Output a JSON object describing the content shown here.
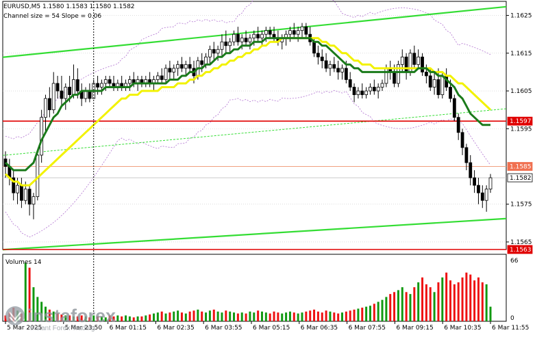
{
  "header": {
    "symbol_line": "EURUSD,M5  1.1580 1.1583 1.1580 1.1582",
    "indicator_line": "Channel size = 54 Slope = 0.06"
  },
  "colors": {
    "background": "#ffffff",
    "grid": "#c8c8c8",
    "candle": "#000000",
    "ma_fast": "#1a7a1a",
    "ma_slow": "#f2f200",
    "channel": "#33dd33",
    "level_line": "#e00000",
    "level_thin": "#f0a080",
    "envelope": "#b070d0",
    "vol_up": "#119911",
    "vol_down": "#ee1111"
  },
  "chart_data": {
    "type": "candlestick",
    "symbol": "EURUSD",
    "timeframe": "M5",
    "ohlc": [
      [
        1.1587,
        1.1589,
        1.1582,
        1.1585
      ],
      [
        1.1585,
        1.1587,
        1.158,
        1.1582
      ],
      [
        1.1582,
        1.1584,
        1.1576,
        1.1578
      ],
      [
        1.1578,
        1.1582,
        1.1575,
        1.158
      ],
      [
        1.158,
        1.1582,
        1.1574,
        1.1576
      ],
      [
        1.1576,
        1.1581,
        1.1575,
        1.1579
      ],
      [
        1.1579,
        1.158,
        1.1572,
        1.1575
      ],
      [
        1.1575,
        1.1578,
        1.1571,
        1.1577
      ],
      [
        1.1577,
        1.1589,
        1.1576,
        1.1588
      ],
      [
        1.1588,
        1.16,
        1.1586,
        1.1598
      ],
      [
        1.1598,
        1.1604,
        1.1594,
        1.1603
      ],
      [
        1.1603,
        1.1606,
        1.1598,
        1.16
      ],
      [
        1.16,
        1.161,
        1.1599,
        1.1607
      ],
      [
        1.1607,
        1.1609,
        1.1603,
        1.1605
      ],
      [
        1.1605,
        1.1609,
        1.1601,
        1.1603
      ],
      [
        1.1603,
        1.1607,
        1.16,
        1.1606
      ],
      [
        1.1606,
        1.1609,
        1.1602,
        1.1604
      ],
      [
        1.1604,
        1.1612,
        1.1603,
        1.1608
      ],
      [
        1.1608,
        1.1611,
        1.1603,
        1.1605
      ],
      [
        1.1605,
        1.1607,
        1.1601,
        1.1603
      ],
      [
        1.1603,
        1.1606,
        1.1602,
        1.1605
      ],
      [
        1.1605,
        1.1607,
        1.1602,
        1.1603
      ],
      [
        1.1603,
        1.1608,
        1.1603,
        1.1607
      ],
      [
        1.1607,
        1.1609,
        1.1604,
        1.1606
      ],
      [
        1.1606,
        1.1608,
        1.1604,
        1.1607
      ],
      [
        1.1607,
        1.1609,
        1.1605,
        1.1608
      ],
      [
        1.1608,
        1.1609,
        1.1606,
        1.1607
      ],
      [
        1.1607,
        1.1609,
        1.1605,
        1.1606
      ],
      [
        1.1606,
        1.1608,
        1.1605,
        1.1607
      ],
      [
        1.1607,
        1.1609,
        1.1605,
        1.1606
      ],
      [
        1.1606,
        1.1608,
        1.1605,
        1.1607
      ],
      [
        1.1607,
        1.1609,
        1.1605,
        1.1608
      ],
      [
        1.1608,
        1.161,
        1.1606,
        1.1607
      ],
      [
        1.1607,
        1.1609,
        1.1605,
        1.1608
      ],
      [
        1.1608,
        1.1609,
        1.1606,
        1.1607
      ],
      [
        1.1607,
        1.1609,
        1.1606,
        1.1608
      ],
      [
        1.1608,
        1.161,
        1.1606,
        1.1607
      ],
      [
        1.1607,
        1.1609,
        1.1605,
        1.1608
      ],
      [
        1.1608,
        1.161,
        1.1607,
        1.1609
      ],
      [
        1.1609,
        1.1611,
        1.1607,
        1.1608
      ],
      [
        1.1608,
        1.1612,
        1.1607,
        1.1611
      ],
      [
        1.1611,
        1.1613,
        1.1608,
        1.161
      ],
      [
        1.161,
        1.1612,
        1.1608,
        1.1611
      ],
      [
        1.1611,
        1.1613,
        1.1609,
        1.1612
      ],
      [
        1.1612,
        1.1614,
        1.161,
        1.1611
      ],
      [
        1.1611,
        1.1613,
        1.1609,
        1.1612
      ],
      [
        1.1612,
        1.1614,
        1.161,
        1.1611
      ],
      [
        1.1611,
        1.1613,
        1.1607,
        1.1609
      ],
      [
        1.1609,
        1.1614,
        1.1608,
        1.1613
      ],
      [
        1.1613,
        1.1615,
        1.161,
        1.1612
      ],
      [
        1.1612,
        1.1615,
        1.1611,
        1.1614
      ],
      [
        1.1614,
        1.1617,
        1.1612,
        1.1616
      ],
      [
        1.1616,
        1.1618,
        1.1613,
        1.1615
      ],
      [
        1.1615,
        1.1617,
        1.1613,
        1.1616
      ],
      [
        1.1616,
        1.162,
        1.1614,
        1.1618
      ],
      [
        1.1618,
        1.1621,
        1.1615,
        1.1617
      ],
      [
        1.1617,
        1.1619,
        1.1615,
        1.1618
      ],
      [
        1.1618,
        1.1621,
        1.1617,
        1.162
      ],
      [
        1.162,
        1.1622,
        1.1617,
        1.1618
      ],
      [
        1.1618,
        1.162,
        1.1616,
        1.1619
      ],
      [
        1.1619,
        1.1621,
        1.1617,
        1.1618
      ],
      [
        1.1618,
        1.162,
        1.1616,
        1.1619
      ],
      [
        1.1619,
        1.1621,
        1.1617,
        1.162
      ],
      [
        1.162,
        1.1622,
        1.1618,
        1.1619
      ],
      [
        1.1619,
        1.1621,
        1.1617,
        1.162
      ],
      [
        1.162,
        1.1622,
        1.1618,
        1.1621
      ],
      [
        1.1621,
        1.1622,
        1.1619,
        1.162
      ],
      [
        1.162,
        1.1622,
        1.1618,
        1.1619
      ],
      [
        1.1619,
        1.1621,
        1.1617,
        1.1618
      ],
      [
        1.1618,
        1.162,
        1.1616,
        1.1619
      ],
      [
        1.1619,
        1.1621,
        1.1617,
        1.162
      ],
      [
        1.162,
        1.1622,
        1.1618,
        1.1621
      ],
      [
        1.1621,
        1.1623,
        1.1619,
        1.162
      ],
      [
        1.162,
        1.1622,
        1.1618,
        1.1621
      ],
      [
        1.1621,
        1.1623,
        1.1619,
        1.1622
      ],
      [
        1.1622,
        1.1623,
        1.1619,
        1.162
      ],
      [
        1.162,
        1.1622,
        1.1617,
        1.1618
      ],
      [
        1.1618,
        1.1619,
        1.1614,
        1.1615
      ],
      [
        1.1615,
        1.1617,
        1.1612,
        1.1614
      ],
      [
        1.1614,
        1.1616,
        1.1611,
        1.1613
      ],
      [
        1.1613,
        1.1615,
        1.161,
        1.1611
      ],
      [
        1.1611,
        1.1613,
        1.1609,
        1.1612
      ],
      [
        1.1612,
        1.1614,
        1.161,
        1.1611
      ],
      [
        1.1611,
        1.1613,
        1.1608,
        1.161
      ],
      [
        1.161,
        1.1612,
        1.1608,
        1.1611
      ],
      [
        1.1611,
        1.1613,
        1.1607,
        1.1608
      ],
      [
        1.1608,
        1.161,
        1.1605,
        1.1606
      ],
      [
        1.1606,
        1.1607,
        1.1602,
        1.1604
      ],
      [
        1.1604,
        1.1606,
        1.1603,
        1.1605
      ],
      [
        1.1605,
        1.1607,
        1.1603,
        1.1604
      ],
      [
        1.1604,
        1.1606,
        1.1603,
        1.1605
      ],
      [
        1.1605,
        1.1607,
        1.1604,
        1.1606
      ],
      [
        1.1606,
        1.1608,
        1.1604,
        1.1605
      ],
      [
        1.1605,
        1.1607,
        1.1603,
        1.1606
      ],
      [
        1.1606,
        1.1608,
        1.1605,
        1.1607
      ],
      [
        1.1607,
        1.1612,
        1.1606,
        1.1611
      ],
      [
        1.1611,
        1.1613,
        1.1608,
        1.161
      ],
      [
        1.161,
        1.1612,
        1.1606,
        1.1607
      ],
      [
        1.1607,
        1.1613,
        1.1606,
        1.1612
      ],
      [
        1.1612,
        1.1616,
        1.161,
        1.1614
      ],
      [
        1.1614,
        1.1615,
        1.1608,
        1.161
      ],
      [
        1.161,
        1.1616,
        1.1609,
        1.1615
      ],
      [
        1.1615,
        1.1617,
        1.1611,
        1.1612
      ],
      [
        1.1612,
        1.1616,
        1.1611,
        1.1614
      ],
      [
        1.1614,
        1.1615,
        1.1609,
        1.161
      ],
      [
        1.161,
        1.1612,
        1.1607,
        1.1609
      ],
      [
        1.1609,
        1.1611,
        1.1605,
        1.1606
      ],
      [
        1.1606,
        1.161,
        1.1604,
        1.1608
      ],
      [
        1.1608,
        1.1611,
        1.1603,
        1.1604
      ],
      [
        1.1604,
        1.161,
        1.1603,
        1.1609
      ],
      [
        1.1609,
        1.1611,
        1.1605,
        1.1606
      ],
      [
        1.1606,
        1.1608,
        1.1602,
        1.1603
      ],
      [
        1.1603,
        1.1604,
        1.1597,
        1.1598
      ],
      [
        1.1598,
        1.1599,
        1.1592,
        1.1594
      ],
      [
        1.1594,
        1.1595,
        1.1588,
        1.159
      ],
      [
        1.159,
        1.1591,
        1.1584,
        1.1586
      ],
      [
        1.1586,
        1.1588,
        1.158,
        1.1582
      ],
      [
        1.1582,
        1.1584,
        1.1578,
        1.158
      ],
      [
        1.158,
        1.1582,
        1.1575,
        1.1578
      ],
      [
        1.1578,
        1.158,
        1.1574,
        1.1576
      ],
      [
        1.1576,
        1.158,
        1.1573,
        1.1579
      ],
      [
        1.1579,
        1.1583,
        1.1578,
        1.1582
      ]
    ],
    "moving_averages": [
      {
        "color": "#1a7a1a",
        "values": [
          1.1586,
          1.1585,
          1.1584,
          1.1584,
          1.1584,
          1.1584,
          1.1585,
          1.1586,
          1.1589,
          1.1592,
          1.1594,
          1.1596,
          1.1598,
          1.1599,
          1.1601,
          1.1602,
          1.1603,
          1.1604,
          1.1604,
          1.1605,
          1.1605,
          1.1605,
          1.1605,
          1.1605,
          1.1605,
          1.1606,
          1.1606,
          1.1606,
          1.1606,
          1.1606,
          1.1606,
          1.1606,
          1.1607,
          1.1607,
          1.1607,
          1.1607,
          1.1607,
          1.1607,
          1.1607,
          1.1607,
          1.1607,
          1.1608,
          1.1608,
          1.1608,
          1.1609,
          1.1609,
          1.161,
          1.161,
          1.1611,
          1.1611,
          1.1612,
          1.1612,
          1.1613,
          1.1614,
          1.1614,
          1.1615,
          1.1615,
          1.1616,
          1.1616,
          1.1617,
          1.1617,
          1.1617,
          1.1618,
          1.1618,
          1.1618,
          1.1619,
          1.1619,
          1.1619,
          1.1619,
          1.1619,
          1.1619,
          1.1619,
          1.1619,
          1.1619,
          1.1619,
          1.1619,
          1.1619,
          1.1618,
          1.1618,
          1.1617,
          1.1617,
          1.1616,
          1.1615,
          1.1614,
          1.1613,
          1.1612,
          1.1612,
          1.1611,
          1.1611,
          1.161,
          1.161,
          1.161,
          1.161,
          1.161,
          1.161,
          1.161,
          1.161,
          1.161,
          1.161,
          1.161,
          1.161,
          1.161,
          1.161,
          1.1611,
          1.1611,
          1.1611,
          1.161,
          1.161,
          1.1609,
          1.1609,
          1.1608,
          1.1607,
          1.1606,
          1.1604,
          1.1603,
          1.1601,
          1.1599,
          1.1598,
          1.1597,
          1.1596,
          1.1596,
          1.1596
        ]
      },
      {
        "color": "#f2f200",
        "values": [
          1.1583,
          1.1582,
          1.1581,
          1.1581,
          1.158,
          1.158,
          1.158,
          1.1581,
          1.1582,
          1.1583,
          1.1584,
          1.1585,
          1.1586,
          1.1587,
          1.1588,
          1.1589,
          1.159,
          1.1591,
          1.1592,
          1.1593,
          1.1594,
          1.1595,
          1.1596,
          1.1597,
          1.1598,
          1.1599,
          1.16,
          1.1601,
          1.1602,
          1.1603,
          1.1603,
          1.1604,
          1.1604,
          1.1604,
          1.1605,
          1.1605,
          1.1605,
          1.1605,
          1.1605,
          1.1606,
          1.1606,
          1.1606,
          1.1606,
          1.1607,
          1.1607,
          1.1607,
          1.1608,
          1.1608,
          1.1609,
          1.1609,
          1.161,
          1.161,
          1.1611,
          1.1611,
          1.1612,
          1.1612,
          1.1613,
          1.1613,
          1.1614,
          1.1614,
          1.1615,
          1.1615,
          1.1616,
          1.1616,
          1.1617,
          1.1617,
          1.1618,
          1.1618,
          1.1618,
          1.1619,
          1.1619,
          1.1619,
          1.1619,
          1.1619,
          1.1619,
          1.1619,
          1.1619,
          1.1619,
          1.1619,
          1.1618,
          1.1618,
          1.1617,
          1.1617,
          1.1616,
          1.1615,
          1.1615,
          1.1614,
          1.1613,
          1.1613,
          1.1612,
          1.1612,
          1.1612,
          1.1611,
          1.1611,
          1.1611,
          1.1611,
          1.1611,
          1.1611,
          1.1611,
          1.1611,
          1.1611,
          1.1611,
          1.1611,
          1.1611,
          1.1611,
          1.1611,
          1.1611,
          1.161,
          1.161,
          1.161,
          1.1609,
          1.1609,
          1.1608,
          1.1607,
          1.1607,
          1.1606,
          1.1605,
          1.1604,
          1.1603,
          1.1602,
          1.1601,
          1.16
        ]
      }
    ],
    "volumes": [
      6,
      9,
      14,
      11,
      8,
      60,
      55,
      35,
      25,
      20,
      15,
      12,
      10,
      8,
      7,
      6,
      6,
      5,
      5,
      6,
      5,
      4,
      6,
      5,
      5,
      4,
      6,
      5,
      6,
      5,
      6,
      5,
      4,
      5,
      5,
      6,
      7,
      8,
      9,
      10,
      8,
      9,
      10,
      11,
      9,
      8,
      10,
      11,
      12,
      10,
      9,
      11,
      12,
      10,
      9,
      11,
      10,
      9,
      8,
      9,
      8,
      10,
      9,
      11,
      10,
      9,
      8,
      10,
      9,
      8,
      9,
      10,
      9,
      8,
      9,
      10,
      11,
      12,
      10,
      9,
      11,
      10,
      9,
      8,
      9,
      10,
      11,
      12,
      13,
      14,
      15,
      16,
      18,
      20,
      22,
      25,
      28,
      30,
      32,
      35,
      30,
      28,
      35,
      40,
      45,
      38,
      35,
      30,
      40,
      45,
      50,
      42,
      38,
      40,
      45,
      50,
      48,
      42,
      45,
      40,
      38,
      15
    ],
    "ylim": [
      1.1563,
      1.1628
    ],
    "yticks": [
      {
        "value": 1.1625,
        "label": "1.1625"
      },
      {
        "value": 1.1615,
        "label": "1.1615"
      },
      {
        "value": 1.1605,
        "label": "1.1605"
      },
      {
        "value": 1.1595,
        "label": "1.1595"
      },
      {
        "value": 1.1575,
        "label": "1.1575"
      },
      {
        "value": 1.1565,
        "label": "1.1565"
      }
    ],
    "levels": [
      {
        "value": 1.1597,
        "label": "1.1597",
        "style": "thick-red"
      },
      {
        "value": 1.1585,
        "label": "1.1585",
        "style": "thin-orange"
      },
      {
        "value": 1.1582,
        "label": "1.1582",
        "style": "bid"
      },
      {
        "value": 1.1563,
        "label": "1.1563",
        "style": "thick-red"
      }
    ],
    "channel_lines": [
      {
        "from": [
          0,
          1.1614
        ],
        "to": [
          122,
          1.1627
        ],
        "style": "thick"
      },
      {
        "from": [
          0,
          1.1563
        ],
        "to": [
          122,
          1.1571
        ],
        "style": "thick"
      },
      {
        "from": [
          0,
          1.1588
        ],
        "to": [
          122,
          1.16
        ],
        "style": "dashed"
      }
    ],
    "vertical_marker_index": 22,
    "xticks": [
      {
        "index": 0,
        "label": "5 Mar 2025"
      },
      {
        "index": 17,
        "label": "5 Mar 23:50"
      },
      {
        "index": 30,
        "label": "6 Mar 01:15"
      },
      {
        "index": 44,
        "label": "6 Mar 02:35"
      },
      {
        "index": 58,
        "label": "6 Mar 03:55"
      },
      {
        "index": 72,
        "label": "6 Mar 05:15"
      },
      {
        "index": 86,
        "label": "6 Mar 06:35"
      },
      {
        "index": 100,
        "label": "6 Mar 07:55"
      },
      {
        "index": 114,
        "label": "6 Mar 09:15"
      },
      {
        "index": 128,
        "label": "6 Mar 10:35"
      },
      {
        "index": 142,
        "label": "6 Mar 11:55"
      }
    ],
    "volume_panel": {
      "label": "Volumes 14",
      "ylim": [
        0,
        66
      ],
      "yticks": [
        {
          "value": 66,
          "label": "66"
        },
        {
          "value": 0,
          "label": "0"
        }
      ]
    }
  },
  "watermark": {
    "brand": "instaforex",
    "tagline": "Instant Forex Trading"
  }
}
